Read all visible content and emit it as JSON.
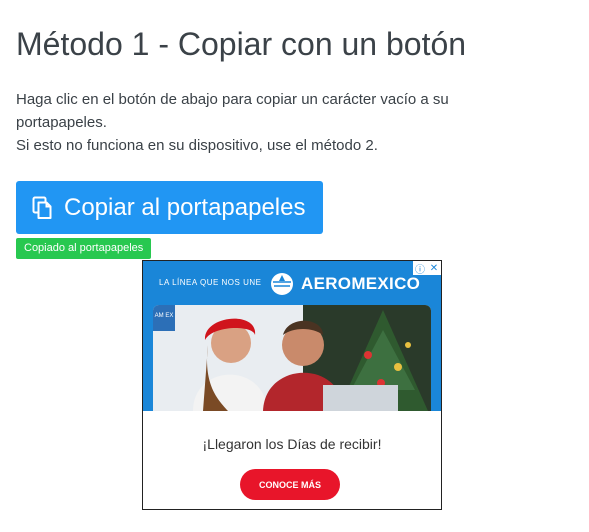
{
  "heading": "Método 1 - Copiar con un botón",
  "instructions": {
    "line1": "Haga clic en el botón de abajo para copiar un carácter vacío a su",
    "line2": "portapapeles.",
    "line3": "Si esto no funciona en su dispositivo, use el método 2."
  },
  "copy_button": {
    "label": "Copiar al portapapeles",
    "icon": "copy-icon",
    "color": "#2196f3"
  },
  "toast": {
    "text": "Copiado al portapapeles",
    "color": "#28c850"
  },
  "ad": {
    "tagline": "LA LÍNEA QUE NOS UNE",
    "brand": "AEROMEXICO",
    "headline": "¡Llegaron los Días de recibir!",
    "cta": "CONOCE MÁS",
    "card_text": "AM EX",
    "colors": {
      "banner": "#1a86d8",
      "cta": "#e8152a"
    }
  }
}
